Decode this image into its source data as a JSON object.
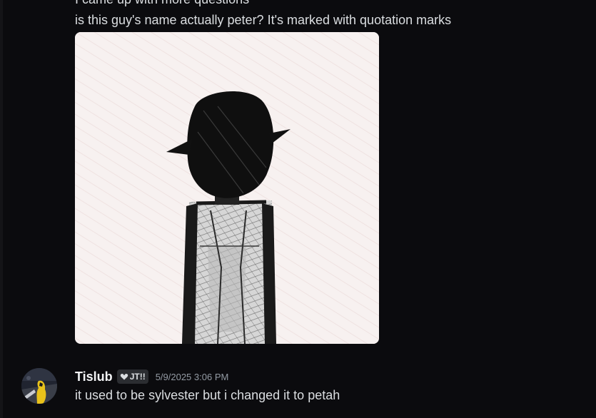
{
  "messages": [
    {
      "continued": true,
      "lines": [
        "I came up with more questions",
        "is this guy's name actually peter? It's marked with quotation marks"
      ],
      "attachment": {
        "kind": "image",
        "subject": "sketched-figure"
      }
    },
    {
      "author": "Tislub",
      "tag": "JT!!",
      "tag_icon": "heart-icon",
      "timestamp": "5/9/2025 3:06 PM",
      "text": "it used to be sylvester but i changed it to petah"
    }
  ],
  "colors": {
    "background": "#0b0b0e",
    "text": "#dbdee1",
    "username": "#f2f3f5",
    "timestamp": "#949ba4",
    "tag_bg": "#2b2d31"
  }
}
